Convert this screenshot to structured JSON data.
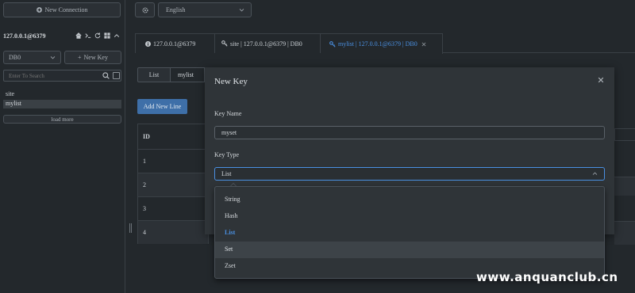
{
  "sidebar": {
    "new_connection_label": "New Connection",
    "connection_name": "127.0.0.1@6379",
    "db_select_value": "DB0",
    "new_key_label": "New Key",
    "search_placeholder": "Enter To Search",
    "keys": [
      "site",
      "mylist"
    ],
    "load_more_label": "load more"
  },
  "header": {
    "language_value": "English"
  },
  "tabs": [
    {
      "label": "127.0.0.1@6379"
    },
    {
      "label": "site | 127.0.0.1@6379 | DB0"
    },
    {
      "label": "mylist | 127.0.0.1@6379 | DB0"
    }
  ],
  "content": {
    "type_badge": "List",
    "key_name": "mylist",
    "add_line_label": "Add New Line",
    "table": {
      "id_header": "ID",
      "rows": [
        "1",
        "2",
        "3",
        "4"
      ]
    }
  },
  "modal": {
    "title": "New Key",
    "key_name_label": "Key Name",
    "key_name_value": "myset",
    "key_type_label": "Key Type",
    "key_type_value": "List",
    "options": [
      "String",
      "Hash",
      "List",
      "Set",
      "Zset"
    ]
  },
  "watermark": "www.anquanclub.cn",
  "colors": {
    "accent": "#4a90e2",
    "background": "#23282c",
    "modal": "#2f3438"
  }
}
